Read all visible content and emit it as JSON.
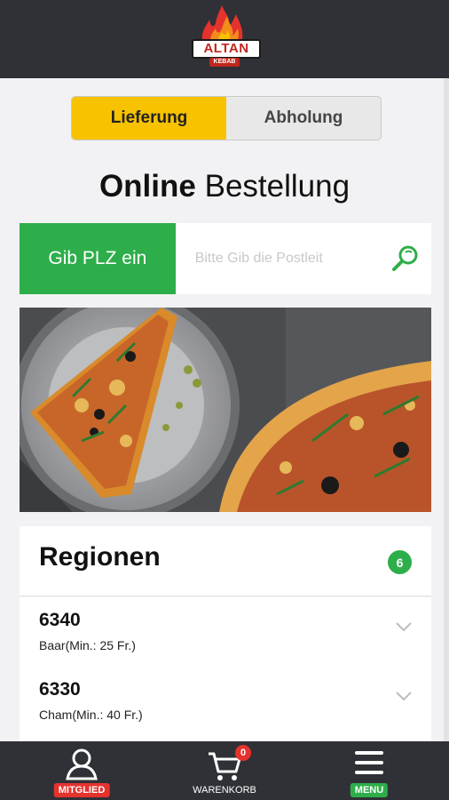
{
  "header": {
    "logo_text": "ALTAN",
    "logo_sub": "KEBAB"
  },
  "delivery_toggle": {
    "options": [
      "Lieferung",
      "Abholung"
    ],
    "selected": "Lieferung"
  },
  "page_title": {
    "bold": "Online",
    "regular": "Bestellung"
  },
  "plz_search": {
    "label": "Gib PLZ ein",
    "placeholder": "Bitte Gib die Postleit",
    "icon": "search-icon"
  },
  "hero": {
    "image": "pizza-photo"
  },
  "regions": {
    "title": "Regionen",
    "count": "6",
    "items": [
      {
        "code": "6340",
        "detail": "Baar(Min.: 25 Fr.)"
      },
      {
        "code": "6330",
        "detail": "Cham(Min.: 40 Fr.)"
      }
    ]
  },
  "bottom_nav": {
    "member": {
      "label": "MITGLIED",
      "icon": "user-icon"
    },
    "cart": {
      "label": "WARENKORB",
      "badge": "0",
      "icon": "cart-icon"
    },
    "menu": {
      "label": "MENU",
      "icon": "hamburger-icon"
    }
  },
  "colors": {
    "header_bg": "#2f3136",
    "accent_yellow": "#f7c200",
    "accent_green": "#2eae4a",
    "accent_red": "#e5322d"
  }
}
